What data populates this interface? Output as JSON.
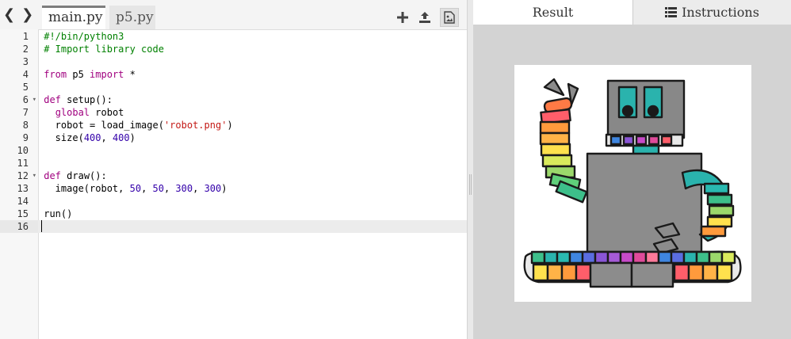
{
  "editor": {
    "tabs": [
      {
        "label": "main.py",
        "active": true
      },
      {
        "label": "p5.py",
        "active": false
      }
    ],
    "toolbar": {
      "icons": [
        "back-icon",
        "forward-icon",
        "add-file-icon",
        "upload-icon",
        "image-icon"
      ]
    },
    "lines": [
      {
        "n": "1",
        "fold": false
      },
      {
        "n": "2",
        "fold": false
      },
      {
        "n": "3",
        "fold": false
      },
      {
        "n": "4",
        "fold": false
      },
      {
        "n": "5",
        "fold": false
      },
      {
        "n": "6",
        "fold": true
      },
      {
        "n": "7",
        "fold": false
      },
      {
        "n": "8",
        "fold": false
      },
      {
        "n": "9",
        "fold": false
      },
      {
        "n": "10",
        "fold": false
      },
      {
        "n": "11",
        "fold": false
      },
      {
        "n": "12",
        "fold": true
      },
      {
        "n": "13",
        "fold": false
      },
      {
        "n": "14",
        "fold": false
      },
      {
        "n": "15",
        "fold": false
      },
      {
        "n": "16",
        "fold": false
      }
    ],
    "code": {
      "l1": "#!/bin/python3",
      "l2": "# Import library code",
      "l4_kw1": "from",
      "l4_mid": " p5 ",
      "l4_kw2": "import",
      "l4_end": " *",
      "l6_kw": "def",
      "l6_rest": " setup():",
      "l7_indent": "  ",
      "l7_kw": "global",
      "l7_rest": " robot",
      "l8_pre": "  robot = load_image(",
      "l8_str": "'robot.png'",
      "l8_end": ")",
      "l9_pre": "  size(",
      "l9_n1": "400",
      "l9_sep": ", ",
      "l9_n2": "400",
      "l9_end": ")",
      "l12_kw": "def",
      "l12_rest": " draw():",
      "l13_pre": "  image(robot, ",
      "l13_n1": "50",
      "l13_s1": ", ",
      "l13_n2": "50",
      "l13_s2": ", ",
      "l13_n3": "300",
      "l13_s3": ", ",
      "l13_n4": "300",
      "l13_end": ")",
      "l15": "run()"
    },
    "current_line": 16,
    "colors": {
      "keyword": "#a0007f",
      "comment": "#008000",
      "string": "#c41a16",
      "number": "#3300aa"
    }
  },
  "output": {
    "tabs": [
      {
        "label": "Result",
        "active": true
      },
      {
        "label": "Instructions",
        "active": false,
        "icon": "list-icon"
      }
    ],
    "canvas": {
      "image": "robot.png"
    }
  }
}
